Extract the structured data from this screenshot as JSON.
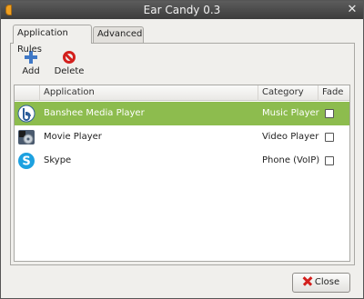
{
  "window": {
    "title": "Ear Candy 0.3"
  },
  "tabs": [
    {
      "label": "Application Rules",
      "active": true
    },
    {
      "label": "Advanced",
      "active": false
    }
  ],
  "toolbar": {
    "add_label": "Add",
    "delete_label": "Delete"
  },
  "table": {
    "columns": {
      "application": "Application",
      "category": "Category",
      "fade": "Fade"
    },
    "rows": [
      {
        "icon": "banshee-icon",
        "application": "Banshee Media Player",
        "category": "Music Player",
        "fade": false,
        "selected": true
      },
      {
        "icon": "movie-player-icon",
        "application": "Movie Player",
        "category": "Video Player",
        "fade": false,
        "selected": false
      },
      {
        "icon": "skype-icon",
        "application": "Skype",
        "category": "Phone (VoIP)",
        "fade": false,
        "selected": false
      }
    ]
  },
  "footer": {
    "close_label": "Close"
  },
  "colors": {
    "selection": "#8dbc4e",
    "titlebar": "#4a4a4a",
    "delete_red": "#d3201d",
    "add_blue": "#3f78c6"
  }
}
